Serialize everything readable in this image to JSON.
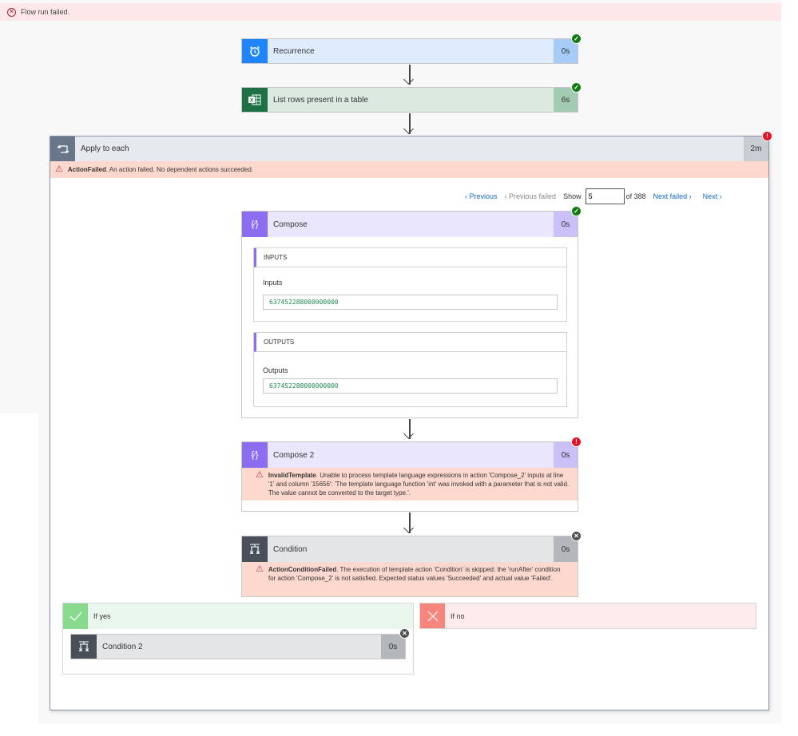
{
  "banner": {
    "icon": "error-circle-icon",
    "text": "Flow run failed."
  },
  "trigger": {
    "title": "Recurrence",
    "duration": "0s",
    "status": "succeeded",
    "icon": "alarm-clock-icon"
  },
  "list_rows": {
    "title": "List rows present in a table",
    "duration": "6s",
    "status": "succeeded",
    "icon": "excel-icon"
  },
  "apply_to_each": {
    "title": "Apply to each",
    "duration": "2m",
    "status": "failed",
    "icon": "loop-icon",
    "error_code": "ActionFailed",
    "error_message": ". An action failed. No dependent actions succeeded."
  },
  "pager": {
    "previous": "Previous",
    "previous_failed": "Previous failed",
    "show_label": "Show",
    "current": "5",
    "of_label": "of 388",
    "next_failed": "Next failed",
    "next": "Next"
  },
  "compose": {
    "title": "Compose",
    "duration": "0s",
    "status": "succeeded",
    "icon": "expression-icon",
    "inputs_header": "INPUTS",
    "inputs_label": "Inputs",
    "inputs_value": "637452288000000000",
    "outputs_header": "OUTPUTS",
    "outputs_label": "Outputs",
    "outputs_value": "637452288000000000"
  },
  "compose2": {
    "title": "Compose 2",
    "duration": "0s",
    "status": "failed",
    "icon": "expression-icon",
    "error_code": "InvalidTemplate",
    "error_message": ". Unable to process template language expressions in action 'Compose_2' inputs at line '1' and column '15656': 'The template language function 'int' was invoked with a parameter that is not valid. The value cannot be converted to the target type.'."
  },
  "condition": {
    "title": "Condition",
    "duration": "0s",
    "status": "skipped",
    "icon": "condition-icon",
    "error_code": "ActionConditionFailed",
    "error_message": ". The execution of template action 'Condition' is skipped: the 'runAfter' condition for action 'Compose_2' is not satisfied. Expected status values 'Succeeded' and actual value 'Failed'."
  },
  "if_yes": {
    "title": "If yes",
    "icon": "checkmark-icon"
  },
  "if_no": {
    "title": "If no",
    "icon": "cross-icon"
  },
  "condition2": {
    "title": "Condition 2",
    "duration": "0s",
    "status": "skipped",
    "icon": "condition-icon"
  },
  "colors": {
    "success": "#107c10",
    "error": "#e81123",
    "skipped": "#505050",
    "link": "#0f6cbd",
    "compose_accent": "#8c6cf0"
  }
}
